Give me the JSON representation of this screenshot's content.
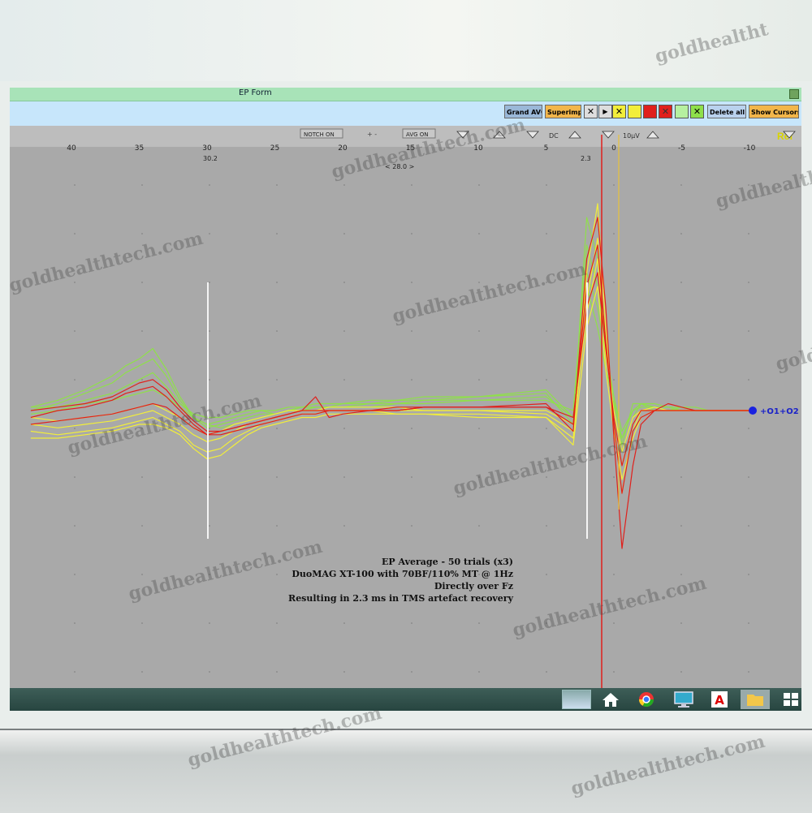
{
  "window": {
    "title": "EP Form"
  },
  "toolbar": {
    "show_cursors": "Show Cursors",
    "delete_all": "Delete all",
    "x_mark": "✕",
    "superimp": "Superimp.",
    "grand_avg": "Grand AVG",
    "arrow_right": "▶"
  },
  "axis": {
    "ref_label": "Ref",
    "scale_label": "10µV",
    "dc_label": "DC",
    "avg_on": "AVG ON",
    "notch_on": "NOTCH ON",
    "plus_minus": "+ -",
    "cursor_gap": "< 28.0 >",
    "cursor_left_label": "30.2",
    "cursor_right_label": "2.3",
    "ticks": [
      "-10",
      "-5",
      "0",
      "5",
      "10",
      "15",
      "20",
      "25",
      "30",
      "35",
      "40"
    ]
  },
  "chart": {
    "channel_label": "+O1+O2",
    "annotation": [
      "EP Average - 50 trials (x3)",
      "DuoMAG XT-100 with 70BF/110% MT @ 1Hz",
      "Directly over Fz",
      "Resulting in 2.3 ms in TMS artefact recovery"
    ]
  },
  "colors": {
    "green": "#8fe04a",
    "yellow": "#f2ee3a",
    "red": "#e0201c",
    "background": "#a9a9a9"
  },
  "taskbar_icons": [
    "app-icon",
    "home-icon",
    "chrome-icon",
    "monitor-icon",
    "acrobat-icon",
    "folder-icon",
    "windows-icon"
  ],
  "chart_data": {
    "type": "line",
    "x_axis": "reversed",
    "xlim": [
      -10,
      43
    ],
    "cursors_ms": [
      30.2,
      2.3
    ],
    "trigger_ms": 0.2,
    "series": [
      {
        "color": "green",
        "y": [
          0.5,
          1.5,
          3,
          5,
          6.5,
          7.5,
          9,
          6,
          2,
          -1,
          -2,
          -1.5,
          -1,
          -0.5,
          0,
          -0.5,
          0,
          0.5,
          0.5,
          0.5,
          0.5,
          1,
          1,
          1.5,
          2,
          3,
          -1,
          20,
          15,
          8,
          2,
          -3,
          0,
          1,
          0,
          0,
          0.5,
          0.5,
          0,
          0,
          0
        ]
      },
      {
        "color": "green",
        "y": [
          0,
          1,
          2.5,
          4,
          5.5,
          6.5,
          7.5,
          5,
          1.5,
          -1,
          -2.5,
          -2,
          -1.5,
          -1,
          -0.5,
          -0.5,
          0,
          0.5,
          0.5,
          0.5,
          1,
          1,
          1.5,
          2,
          2,
          2.5,
          -2,
          28,
          22,
          10,
          0,
          -6,
          -1,
          1,
          1,
          0.5,
          0.5,
          0,
          0,
          0,
          0
        ]
      },
      {
        "color": "green",
        "y": [
          0.5,
          0.5,
          1.5,
          2.5,
          3.5,
          4.5,
          5.5,
          3.5,
          1,
          -0.5,
          -1,
          -1,
          -0.5,
          0,
          0,
          0,
          0.5,
          0.5,
          1,
          1,
          1,
          1.5,
          1.5,
          1.5,
          1.5,
          2,
          -1,
          18,
          12,
          6,
          1,
          -4,
          0,
          0.5,
          0.5,
          0.5,
          0,
          0,
          0,
          0,
          0
        ]
      },
      {
        "color": "green",
        "y": [
          -0.5,
          0,
          1,
          1.5,
          2,
          2.5,
          3,
          2,
          0.5,
          -1,
          -2,
          -2.5,
          -2,
          -1.5,
          -1,
          -0.5,
          0,
          0,
          0.5,
          0.5,
          0.5,
          0.5,
          1,
          1,
          1.5,
          1.5,
          0,
          24,
          18,
          9,
          2,
          -5,
          1,
          1,
          0.5,
          0,
          0,
          0,
          0,
          0,
          0
        ]
      },
      {
        "color": "yellow",
        "y": [
          -3,
          -3.5,
          -3,
          -2.5,
          -2,
          -1.5,
          -1,
          -2,
          -3,
          -5,
          -6,
          -5.5,
          -4,
          -3,
          -2,
          -1.5,
          -1,
          -0.5,
          -0.5,
          0,
          0,
          0,
          -0.5,
          -0.5,
          -0.5,
          -1,
          -4,
          16,
          25,
          10,
          -2,
          -12,
          -3,
          0,
          0.5,
          0,
          0,
          0,
          0,
          0,
          0
        ]
      },
      {
        "color": "yellow",
        "y": [
          -2,
          -2.5,
          -2,
          -1.5,
          -1,
          -0.5,
          0,
          -1,
          -2,
          -3.5,
          -4.5,
          -4,
          -3,
          -2,
          -1.5,
          -1,
          -0.5,
          0,
          0,
          0,
          0,
          0,
          0,
          0,
          0,
          -0.5,
          -3,
          20,
          30,
          12,
          -1,
          -8,
          -2,
          0,
          0,
          0,
          0,
          0,
          0,
          0,
          0
        ]
      },
      {
        "color": "yellow",
        "y": [
          -1,
          -1.5,
          -1,
          -0.5,
          0,
          0.5,
          1,
          0,
          -1,
          -2.5,
          -3.5,
          -3,
          -2,
          -1.5,
          -1,
          -0.5,
          0,
          0,
          0,
          0.5,
          0.5,
          0.5,
          0.5,
          0,
          0,
          0,
          -2,
          14,
          22,
          8,
          0,
          -6,
          -1,
          0,
          0,
          0,
          0,
          0,
          0,
          0,
          0
        ]
      },
      {
        "color": "yellow",
        "y": [
          -4,
          -4,
          -3.5,
          -3,
          -2.5,
          -2,
          -2,
          -2.5,
          -3.5,
          -5.5,
          -7,
          -6.5,
          -5,
          -3.5,
          -2.5,
          -2,
          -1.5,
          -1,
          -1,
          -0.5,
          -0.5,
          -0.5,
          -0.5,
          -0.5,
          -1,
          -1,
          -5,
          12,
          18,
          6,
          -3,
          -10,
          -4,
          -1,
          0,
          0,
          0,
          0,
          0,
          0,
          0
        ]
      },
      {
        "color": "red",
        "y": [
          0,
          0.5,
          1,
          2,
          3,
          4,
          4.5,
          3,
          0.5,
          -1.5,
          -3,
          -3,
          -2.5,
          -2,
          -1.5,
          -1,
          -0.5,
          0,
          2,
          -1,
          -0.5,
          0,
          0,
          0.5,
          0.5,
          1,
          -3,
          22,
          28,
          15,
          -4,
          -20,
          -8,
          -2,
          0,
          1,
          0.5,
          0,
          0,
          0,
          0
        ]
      },
      {
        "color": "red",
        "y": [
          -1,
          0,
          0.5,
          1.5,
          2.5,
          3,
          3.5,
          2,
          0,
          -2,
          -3.5,
          -3.5,
          -3,
          -2.5,
          -2,
          -1.5,
          -1,
          -0.5,
          -0.5,
          0,
          0,
          0,
          0.5,
          0.5,
          0.5,
          0.5,
          -2,
          18,
          24,
          10,
          -2,
          -12,
          -3,
          -1,
          0,
          0,
          0,
          0,
          0,
          0,
          0
        ]
      },
      {
        "color": "red",
        "y": [
          -2,
          -1.5,
          -1,
          -0.5,
          0,
          0.5,
          1,
          0.5,
          -1,
          -2.5,
          -3.5,
          -3,
          -2.5,
          -2,
          -1.5,
          -1,
          -0.5,
          0,
          0,
          0,
          0,
          0,
          0,
          0.5,
          0.5,
          0.5,
          -1,
          15,
          20,
          9,
          -1,
          -8,
          -2,
          0,
          0,
          0,
          0,
          0,
          0,
          0,
          0
        ]
      }
    ]
  }
}
